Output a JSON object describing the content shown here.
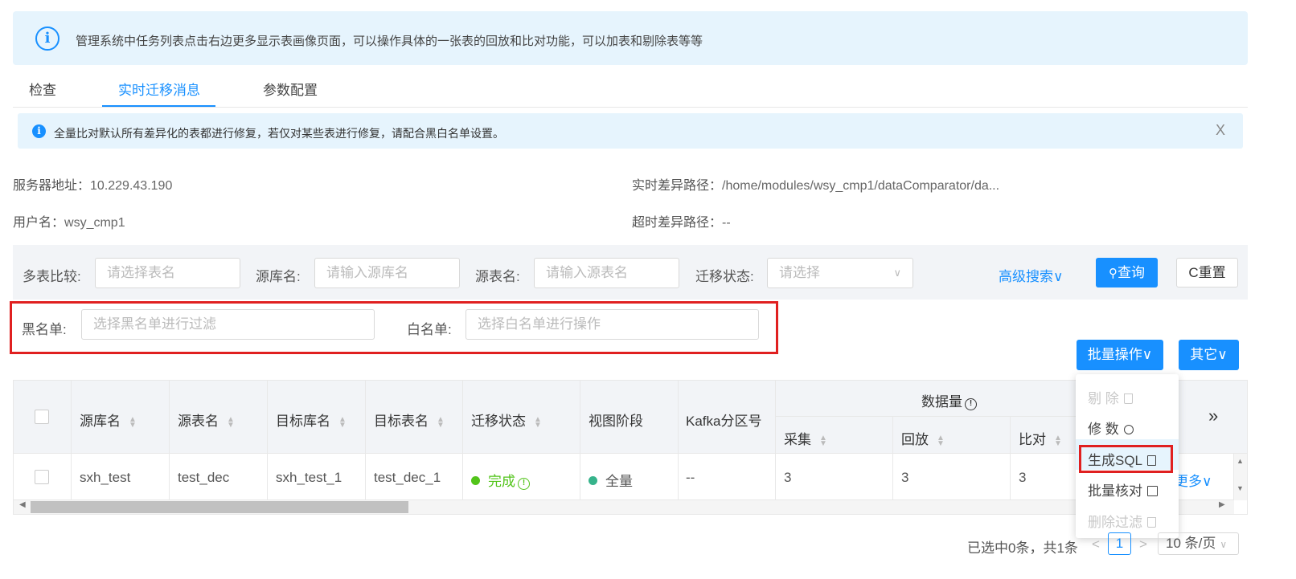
{
  "top_banner": {
    "icon": "info-icon",
    "text": "管理系统中任务列表点击右边更多显示表画像页面，可以操作具体的一张表的回放和比对功能，可以加表和剔除表等等"
  },
  "tabs": [
    {
      "label": "检查"
    },
    {
      "label": "实时迁移消息"
    },
    {
      "label": "参数配置"
    }
  ],
  "notice": {
    "text": "全量比对默认所有差异化的表都进行修复，若仅对某些表进行修复，请配合黑白名单设置。",
    "close": "X"
  },
  "meta": {
    "server_label": "服务器地址：",
    "server_value": "10.229.43.190",
    "user_label": "用户名：",
    "user_value": "wsy_cmp1",
    "realtime_label": "实时差异路径：",
    "realtime_value": "/home/modules/wsy_cmp1/dataComparator/da...",
    "timeout_label": "超时差异路径：",
    "timeout_value": "--"
  },
  "filters": {
    "multi_label": "多表比较:",
    "multi_placeholder": "请选择表名",
    "srcdb_label": "源库名:",
    "srcdb_placeholder": "请输入源库名",
    "srctable_label": "源表名:",
    "srctable_placeholder": "请输入源表名",
    "status_label": "迁移状态:",
    "status_placeholder": "请选择",
    "advanced": "高级搜索∨",
    "search_btn": "查询",
    "reset_btn": "重置"
  },
  "lists": {
    "black_label": "黑名单:",
    "black_placeholder": "选择黑名单进行过滤",
    "white_label": "白名单:",
    "white_placeholder": "选择白名单进行操作"
  },
  "actions": {
    "batch": "批量操作∨",
    "other": "其它∨"
  },
  "table": {
    "headers": {
      "src_db": "源库名",
      "src_table": "源表名",
      "tgt_db": "目标库名",
      "tgt_table": "目标表名",
      "status": "迁移状态",
      "view_stage": "视图阶段",
      "kafka": "Kafka分区号",
      "data_volume": "数据量",
      "collect": "采集",
      "replay": "回放",
      "compare": "比对",
      "expand": "»"
    },
    "rows": [
      {
        "src_db": "sxh_test",
        "src_table": "test_dec",
        "tgt_db": "sxh_test_1",
        "tgt_table": "test_dec_1",
        "status": "完成",
        "view_stage": "全量",
        "kafka": "--",
        "collect": "3",
        "replay": "3",
        "compare": "3",
        "more": "更多∨"
      }
    ]
  },
  "dropdown": {
    "items": [
      {
        "label": "剔 除",
        "disabled": true
      },
      {
        "label": "修 数",
        "disabled": false
      },
      {
        "label": "生成SQL",
        "disabled": false
      },
      {
        "label": "批量核对",
        "disabled": false
      },
      {
        "label": "删除过滤",
        "disabled": true
      }
    ]
  },
  "pagination": {
    "summary": "已选中0条，共1条",
    "prev": "<",
    "current": "1",
    "next": ">",
    "page_size": "10 条/页"
  },
  "colors": {
    "accent": "#1890ff",
    "highlight_box": "#e02020",
    "success": "#52c41a",
    "teal": "#36b38b"
  }
}
